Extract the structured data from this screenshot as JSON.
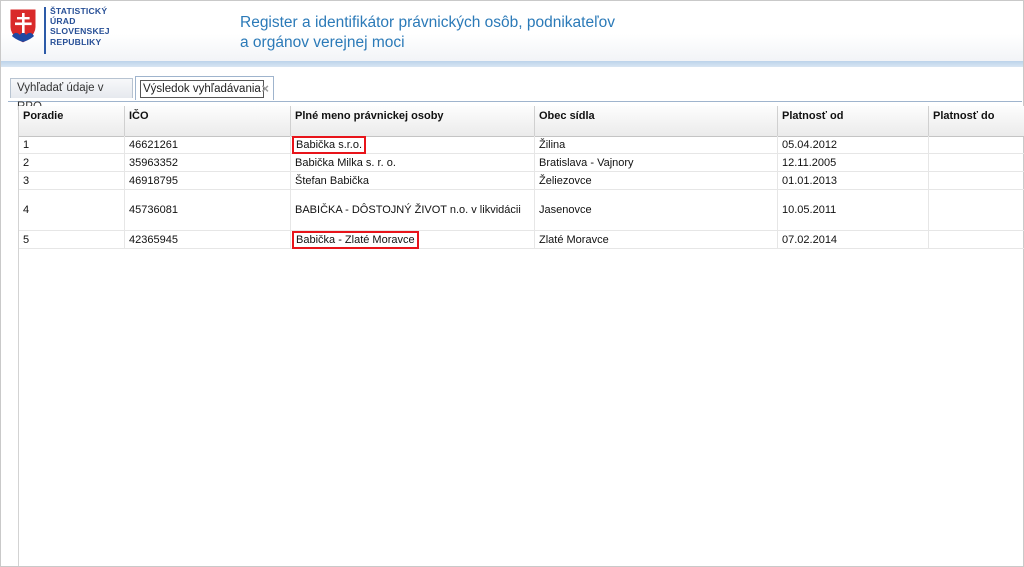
{
  "header": {
    "org_lines": [
      "ŠTATISTICKÝ",
      "ÚRAD",
      "SLOVENSKEJ",
      "REPUBLIKY"
    ],
    "title_lines": [
      "Register a identifikátor právnických osôb, podnikateľov",
      "a orgánov verejnej moci"
    ],
    "colors": {
      "title": "#2b7ab8",
      "org": "#274f96",
      "shield_red": "#d92a2a",
      "shield_blue": "#1f4aa3"
    }
  },
  "tabs": [
    {
      "label": "Vyhľadať údaje v RPO",
      "active": false
    },
    {
      "label": "Výsledok vyhľadávania",
      "active": true,
      "close_icon": "close-icon"
    }
  ],
  "grid": {
    "columns": [
      "Poradie",
      "IČO",
      "Plné meno právnickej osoby",
      "Obec sídla",
      "Platnosť od",
      "Platnosť do"
    ],
    "rows": [
      {
        "poradie": "1",
        "ico": "46621261",
        "meno": "Babička s.r.o.",
        "obec": "Žilina",
        "od": "05.04.2012",
        "do": "",
        "highlighted": true
      },
      {
        "poradie": "2",
        "ico": "35963352",
        "meno": "Babička Milka s. r. o.",
        "obec": "Bratislava - Vajnory",
        "od": "12.11.2005",
        "do": "",
        "highlighted": false
      },
      {
        "poradie": "3",
        "ico": "46918795",
        "meno": "Štefan Babička",
        "obec": "Želiezovce",
        "od": "01.01.2013",
        "do": "",
        "highlighted": false
      },
      {
        "poradie": "4",
        "ico": "45736081",
        "meno": "BABIČKA - DÔSTOJNÝ ŽIVOT n.o. v likvidácii",
        "obec": "Jasenovce",
        "od": "10.05.2011",
        "do": "",
        "highlighted": false
      },
      {
        "poradie": "5",
        "ico": "42365945",
        "meno": "Babička - Zlaté Moravce",
        "obec": "Zlaté Moravce",
        "od": "07.02.2014",
        "do": "",
        "highlighted": true
      }
    ],
    "highlight_color": "#e8141a"
  }
}
